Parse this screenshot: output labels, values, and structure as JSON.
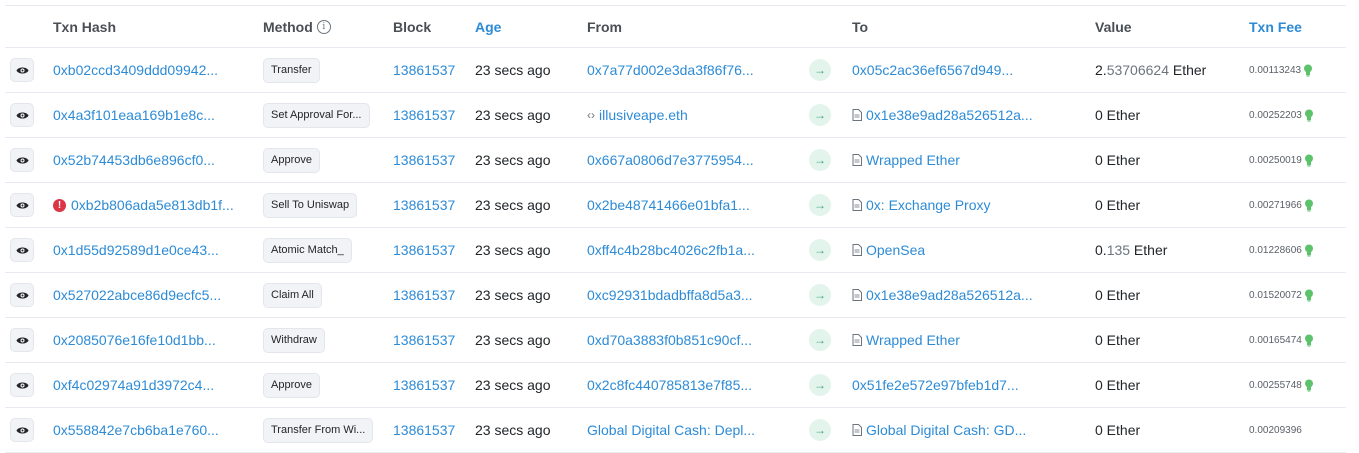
{
  "header": {
    "txn_hash": "Txn Hash",
    "method": "Method",
    "block": "Block",
    "age": "Age",
    "from": "From",
    "to": "To",
    "value": "Value",
    "txn_fee": "Txn Fee"
  },
  "colors": {
    "link": "#2d8bd6",
    "error": "#dc3545",
    "arrow": "#3aa374"
  },
  "rows": [
    {
      "hash": "0xb02ccd3409ddd09942...",
      "method": "Transfer",
      "block": "13861537",
      "age": "23 secs ago",
      "from": "0x7a77d002e3da3f86f76...",
      "to": "0x05c2ac36ef6567d949...",
      "value_main": "2.",
      "value_dim": "53706624",
      "value_unit": " Ether",
      "fee": "0.00113243"
    },
    {
      "hash": "0x4a3f101eaa169b1e8c...",
      "method": "Set Approval For...",
      "block": "13861537",
      "age": "23 secs ago",
      "from": "illusiveape.eth",
      "to": "0x1e38e9ad28a526512a...",
      "value_main": "0",
      "value_dim": "",
      "value_unit": " Ether",
      "fee": "0.00252203"
    },
    {
      "hash": "0x52b74453db6e896cf0...",
      "method": "Approve",
      "block": "13861537",
      "age": "23 secs ago",
      "from": "0x667a0806d7e3775954...",
      "to": "Wrapped Ether",
      "value_main": "0",
      "value_dim": "",
      "value_unit": " Ether",
      "fee": "0.00250019"
    },
    {
      "hash": "0xb2b806ada5e813db1f...",
      "method": "Sell To Uniswap",
      "block": "13861537",
      "age": "23 secs ago",
      "from": "0x2be48741466e01bfa1...",
      "to": "0x: Exchange Proxy",
      "value_main": "0",
      "value_dim": "",
      "value_unit": " Ether",
      "fee": "0.00271966"
    },
    {
      "hash": "0x1d55d92589d1e0ce43...",
      "method": "Atomic Match_",
      "block": "13861537",
      "age": "23 secs ago",
      "from": "0xff4c4b28bc4026c2fb1a...",
      "to": "OpenSea",
      "value_main": "0.",
      "value_dim": "135",
      "value_unit": " Ether",
      "fee": "0.01228606"
    },
    {
      "hash": "0x527022abce86d9ecfc5...",
      "method": "Claim All",
      "block": "13861537",
      "age": "23 secs ago",
      "from": "0xc92931bdadbffa8d5a3...",
      "to": "0x1e38e9ad28a526512a...",
      "value_main": "0",
      "value_dim": "",
      "value_unit": " Ether",
      "fee": "0.01520072"
    },
    {
      "hash": "0x2085076e16fe10d1bb...",
      "method": "Withdraw",
      "block": "13861537",
      "age": "23 secs ago",
      "from": "0xd70a3883f0b851c90cf...",
      "to": "Wrapped Ether",
      "value_main": "0",
      "value_dim": "",
      "value_unit": " Ether",
      "fee": "0.00165474"
    },
    {
      "hash": "0xf4c02974a91d3972c4...",
      "method": "Approve",
      "block": "13861537",
      "age": "23 secs ago",
      "from": "0x2c8fc440785813e7f85...",
      "to": "0x51fe2e572e97bfeb1d7...",
      "value_main": "0",
      "value_dim": "",
      "value_unit": " Ether",
      "fee": "0.00255748"
    },
    {
      "hash": "0x558842e7cb6ba1e760...",
      "method": "Transfer From Wi...",
      "block": "13861537",
      "age": "23 secs ago",
      "from": "Global Digital Cash: Depl...",
      "to": "Global Digital Cash: GD...",
      "value_main": "0",
      "value_dim": "",
      "value_unit": " Ether",
      "fee": "0.00209396"
    }
  ],
  "row_flags": [
    {
      "error": false,
      "from_code": false,
      "to_doc": false,
      "fee_icon": true
    },
    {
      "error": false,
      "from_code": true,
      "to_doc": true,
      "fee_icon": true
    },
    {
      "error": false,
      "from_code": false,
      "to_doc": true,
      "fee_icon": true
    },
    {
      "error": true,
      "from_code": false,
      "to_doc": true,
      "fee_icon": true
    },
    {
      "error": false,
      "from_code": false,
      "to_doc": true,
      "fee_icon": true
    },
    {
      "error": false,
      "from_code": false,
      "to_doc": true,
      "fee_icon": true
    },
    {
      "error": false,
      "from_code": false,
      "to_doc": true,
      "fee_icon": true
    },
    {
      "error": false,
      "from_code": false,
      "to_doc": false,
      "fee_icon": true
    },
    {
      "error": false,
      "from_code": false,
      "to_doc": true,
      "fee_icon": false
    }
  ],
  "icons": {
    "view": "eye-icon",
    "direction": "arrow-right-icon",
    "contract": "document-icon",
    "fee": "bulb-icon",
    "error": "exclamation-icon",
    "ens": "code-icon",
    "info": "info-icon"
  }
}
